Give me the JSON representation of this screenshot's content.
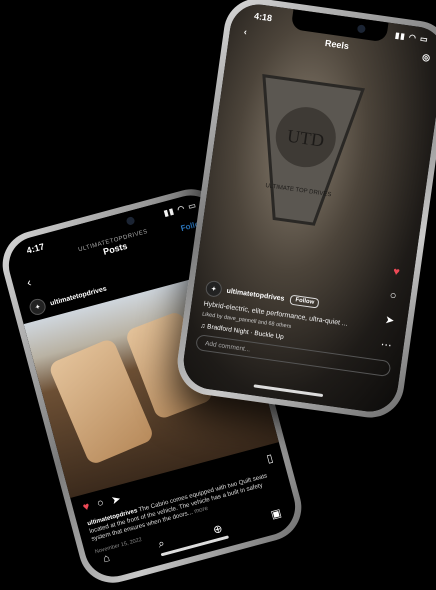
{
  "post_phone": {
    "status_time": "4:17",
    "account_header": "ULTIMATETOPDRIVES",
    "title": "Posts",
    "follow_label": "Follow",
    "username": "ultimatetopdrives",
    "caption_user": "ultimatetopdrives",
    "caption_text": "The Cabrio comes equipped with two Quilt seats located at the front of the vehicle. The vehicle has a built in safety system that ensures when the doors...",
    "more_label": "more",
    "date": "November 15, 2022"
  },
  "reel_phone": {
    "status_time": "4:18",
    "title": "Reels",
    "username": "ultimatetopdrives",
    "follow_label": "Follow",
    "caption": "Hybrid-electric, elite performance, ultra-quiet ...",
    "liked_by": "Liked by dave_pannell and 68 others",
    "music": "Bradford Night · Buckle Up",
    "comment_placeholder": "Add comment...",
    "emblem_text_top": "UTD",
    "emblem_text_bottom": "ULTIMATE TOP DRIVES"
  },
  "icons": [
    "back-icon",
    "more-icon",
    "heart-icon",
    "comment-icon",
    "share-icon",
    "bookmark-icon",
    "home-icon",
    "search-icon",
    "add-icon",
    "reels-icon",
    "camera-icon",
    "music-icon"
  ]
}
